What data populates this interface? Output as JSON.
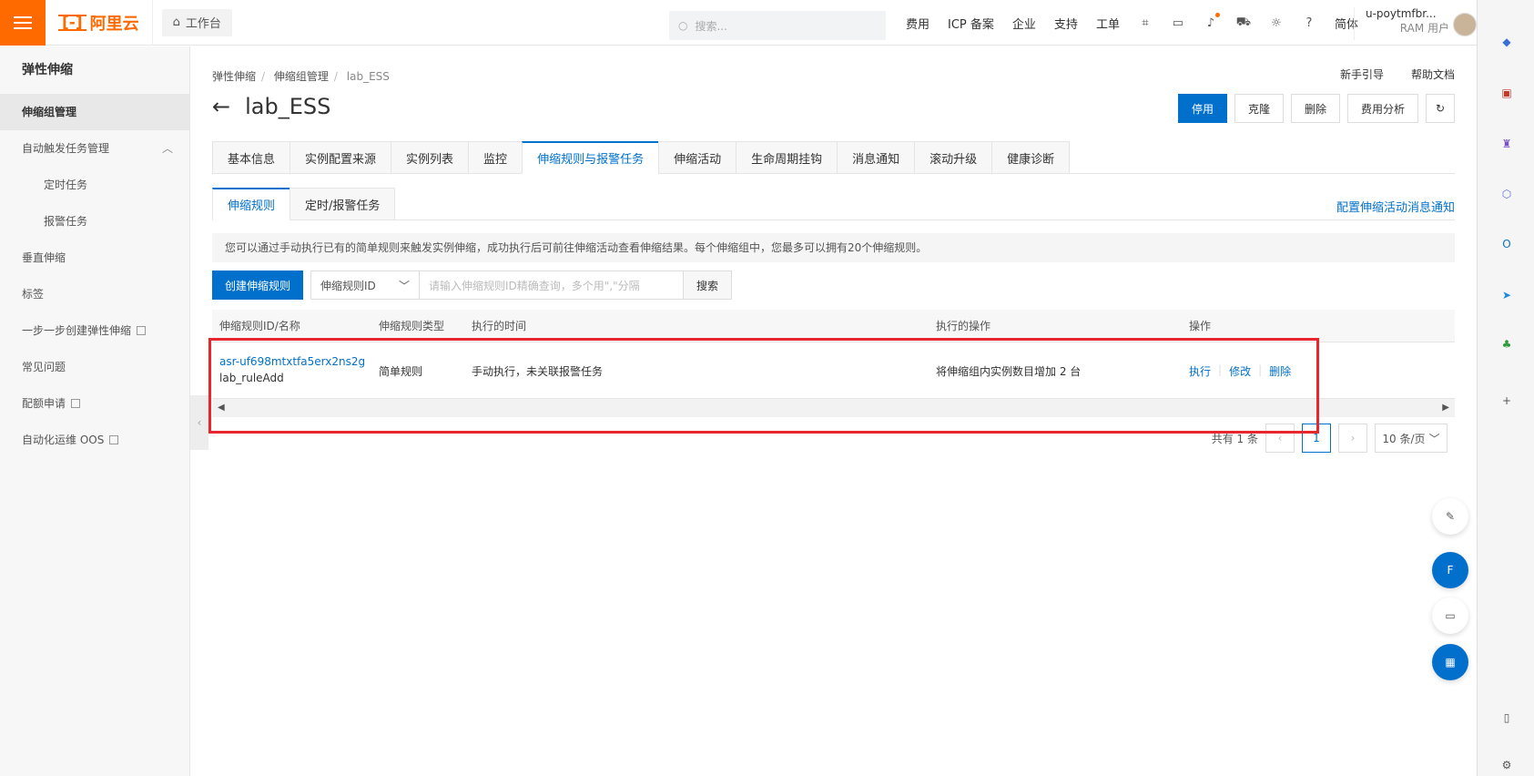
{
  "topbar": {
    "logo_text": "阿里云",
    "workbench": "工作台",
    "search_placeholder": "搜索...",
    "nav": [
      "费用",
      "ICP 备案",
      "企业",
      "支持",
      "工单"
    ],
    "lang": "简体",
    "user_name": "u-poytmfbr...",
    "user_role": "RAM 用户"
  },
  "sidebar": {
    "title": "弹性伸缩",
    "items": [
      {
        "label": "伸缩组管理",
        "active": true
      },
      {
        "label": "自动触发任务管理"
      },
      {
        "label": "定时任务"
      },
      {
        "label": "报警任务"
      },
      {
        "label": "垂直伸缩"
      },
      {
        "label": "标签"
      },
      {
        "label": "一步一步创建弹性伸缩"
      },
      {
        "label": "常见问题"
      },
      {
        "label": "配额申请"
      },
      {
        "label": "自动化运维 OOS"
      }
    ]
  },
  "breadcrumb": [
    "弹性伸缩",
    "伸缩组管理",
    "lab_ESS"
  ],
  "help": {
    "guide": "新手引导",
    "docs": "帮助文档"
  },
  "page": {
    "title": "lab_ESS"
  },
  "actions": {
    "disable": "停用",
    "clone": "克隆",
    "delete": "删除",
    "cost": "费用分析"
  },
  "tabs": [
    "基本信息",
    "实例配置来源",
    "实例列表",
    "监控",
    "伸缩规则与报警任务",
    "伸缩活动",
    "生命周期挂钩",
    "消息通知",
    "滚动升级",
    "健康诊断"
  ],
  "subtabs": [
    "伸缩规则",
    "定时/报警任务"
  ],
  "config_link": "配置伸缩活动消息通知",
  "notice": "您可以通过手动执行已有的简单规则来触发实例伸缩，成功执行后可前往伸缩活动查看伸缩结果。每个伸缩组中，您最多可以拥有20个伸缩规则。",
  "toolbar": {
    "create": "创建伸缩规则",
    "select": "伸缩规则ID",
    "input_placeholder": "请输入伸缩规则ID精确查询，多个用\",\"分隔",
    "search": "搜索"
  },
  "table": {
    "headers": [
      "伸缩规则ID/名称",
      "伸缩规则类型",
      "执行的时间",
      "执行的操作",
      "操作"
    ],
    "rows": [
      {
        "id": "asr-uf698mtxtfa5erx2ns2g",
        "name": "lab_ruleAdd",
        "type": "简单规则",
        "time": "手动执行，未关联报警任务",
        "op": "将伸缩组内实例数目增加 2 台",
        "actions": [
          "执行",
          "修改",
          "删除"
        ]
      }
    ]
  },
  "pager": {
    "total": "共有 1 条",
    "current": "1",
    "size": "10 条/页"
  }
}
